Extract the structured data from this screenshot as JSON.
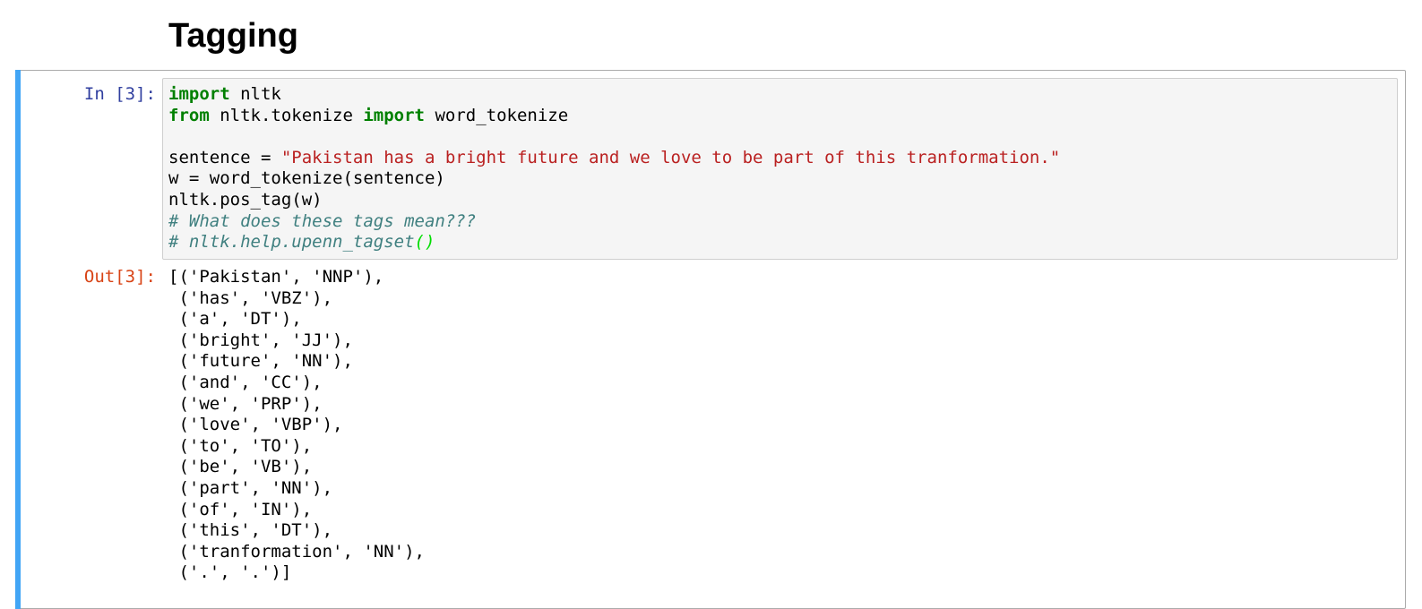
{
  "notebook": {
    "heading": "Tagging",
    "cell": {
      "in_prompt": "In [3]:",
      "out_prompt": "Out[3]:",
      "code": {
        "line1_kw": "import",
        "line1_rest": " nltk",
        "line2_kw1": "from",
        "line2_mid": " nltk.tokenize ",
        "line2_kw2": "import",
        "line2_rest": " word_tokenize",
        "line4_lhs": "sentence = ",
        "line4_str": "\"Pakistan has a bright future and we love to be part of this tranformation.\"",
        "line5": "w = word_tokenize(sentence)",
        "line6": "nltk.pos_tag(w)",
        "line7_comment": "# What does these tags mean???",
        "line8_comment": "# nltk.help.upenn_tagset",
        "line8_paren": "()"
      },
      "output_lines": [
        "[('Pakistan', 'NNP'),",
        " ('has', 'VBZ'),",
        " ('a', 'DT'),",
        " ('bright', 'JJ'),",
        " ('future', 'NN'),",
        " ('and', 'CC'),",
        " ('we', 'PRP'),",
        " ('love', 'VBP'),",
        " ('to', 'TO'),",
        " ('be', 'VB'),",
        " ('part', 'NN'),",
        " ('of', 'IN'),",
        " ('this', 'DT'),",
        " ('tranformation', 'NN'),",
        " ('.', '.')]"
      ]
    }
  },
  "colors": {
    "selected_cell_bar": "#42a5f5",
    "in_prompt": "#303f9f",
    "out_prompt": "#d84315",
    "keyword": "#008000",
    "string": "#ba2121",
    "comment": "#408080"
  }
}
